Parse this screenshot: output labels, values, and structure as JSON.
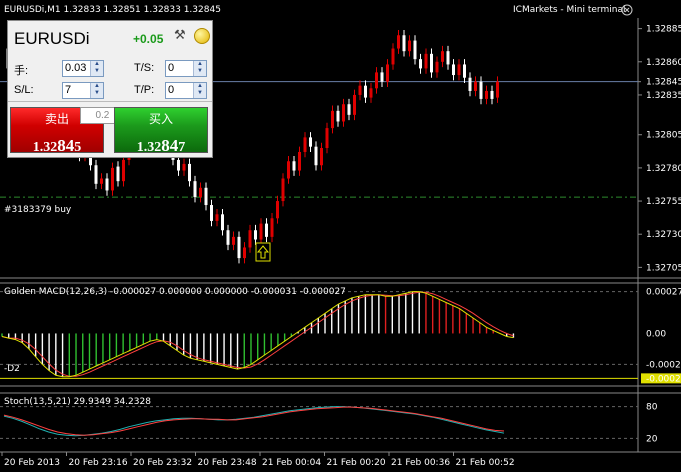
{
  "window": {
    "title": "EURUSDi,M1 1.32833 1.32851 1.32833 1.32845",
    "terminal_label": "ICMarkets - Mini terminal",
    "close_glyph": "ⓧ"
  },
  "panel": {
    "symbol": "EURUSDi",
    "change": "+0.05",
    "lots_label": "手:",
    "lots_value": "0.03",
    "sl_label": "S/L:",
    "sl_value": "7",
    "ts_label": "T/S:",
    "ts_value": "0",
    "tp_label": "T/P:",
    "tp_value": "0",
    "volume_step": "0.2",
    "sell_label": "卖出",
    "sell_price_small": "1.32",
    "sell_price_big": "84",
    "sell_price_tail": "5",
    "buy_label": "买入",
    "buy_price_small": "1.32",
    "buy_price_big": "84",
    "buy_price_tail": "7"
  },
  "icons": {
    "tool": "tools-icon",
    "coin": "coin-icon",
    "arrow": "up-arrow-icon",
    "spin": "spinner-arrows-icon"
  },
  "colors": {
    "bull": "#ffffff",
    "bear": "#e00000",
    "grid": "#666666",
    "order_line": "#2e8b2e",
    "bid_line": "#6a7fa8",
    "macd_line": "#e0e000",
    "signal_line": "#ff4040",
    "stoch_main": "#20b0b0",
    "stoch_signal": "#ff4040"
  },
  "chart_data": [
    {
      "type": "candlestick",
      "title": "EURUSDi,M1 1.32833 1.32851 1.32833 1.32845",
      "y_ticks": [
        "1.32885",
        "1.32860",
        "1.32845",
        "1.32835",
        "1.32805",
        "1.32780",
        "1.32755",
        "1.32730",
        "1.32705"
      ],
      "current_price": "1.32845",
      "order_label": "#3183379 buy",
      "order_price": 1.32758,
      "x_ticks": [
        "20 Feb 2013",
        "20 Feb 23:16",
        "20 Feb 23:32",
        "20 Feb 23:48",
        "21 Feb 00:04",
        "21 Feb 00:20",
        "21 Feb 00:36",
        "21 Feb 00:52"
      ],
      "candles": [
        [
          1.3287,
          1.32855
        ],
        [
          1.32856,
          1.32848
        ],
        [
          1.3285,
          1.32862
        ],
        [
          1.32861,
          1.32845
        ],
        [
          1.32846,
          1.32838
        ],
        [
          1.32838,
          1.32852
        ],
        [
          1.32853,
          1.3284
        ],
        [
          1.3284,
          1.32825
        ],
        [
          1.32826,
          1.32833
        ],
        [
          1.32834,
          1.32818
        ],
        [
          1.32818,
          1.32808
        ],
        [
          1.32808,
          1.32815
        ],
        [
          1.32815,
          1.32798
        ],
        [
          1.32797,
          1.32789
        ],
        [
          1.32789,
          1.32795
        ],
        [
          1.32795,
          1.32782
        ],
        [
          1.32782,
          1.32768
        ],
        [
          1.32768,
          1.32772
        ],
        [
          1.32772,
          1.32763
        ],
        [
          1.32763,
          1.3278
        ],
        [
          1.32781,
          1.3277
        ],
        [
          1.3277,
          1.32786
        ],
        [
          1.32786,
          1.328
        ],
        [
          1.328,
          1.32792
        ],
        [
          1.32792,
          1.32806
        ],
        [
          1.32806,
          1.32798
        ],
        [
          1.32798,
          1.32812
        ],
        [
          1.32812,
          1.32803
        ],
        [
          1.32803,
          1.32795
        ],
        [
          1.32795,
          1.328
        ],
        [
          1.328,
          1.32786
        ],
        [
          1.32786,
          1.32778
        ],
        [
          1.32778,
          1.32783
        ],
        [
          1.32783,
          1.3277
        ],
        [
          1.3277,
          1.32758
        ],
        [
          1.32758,
          1.32765
        ],
        [
          1.32765,
          1.32752
        ],
        [
          1.32752,
          1.3274
        ],
        [
          1.3274,
          1.32745
        ],
        [
          1.32745,
          1.32733
        ],
        [
          1.32733,
          1.32722
        ],
        [
          1.32722,
          1.32728
        ],
        [
          1.32728,
          1.32712
        ],
        [
          1.32712,
          1.3272
        ],
        [
          1.3272,
          1.32733
        ],
        [
          1.32733,
          1.32726
        ],
        [
          1.32726,
          1.32738
        ],
        [
          1.32738,
          1.32728
        ],
        [
          1.32728,
          1.32742
        ],
        [
          1.32742,
          1.32755
        ],
        [
          1.32755,
          1.32772
        ],
        [
          1.32772,
          1.32785
        ],
        [
          1.32785,
          1.32778
        ],
        [
          1.32778,
          1.32792
        ],
        [
          1.32792,
          1.32803
        ],
        [
          1.32803,
          1.32796
        ],
        [
          1.32796,
          1.32782
        ],
        [
          1.32782,
          1.32795
        ],
        [
          1.32795,
          1.3281
        ],
        [
          1.3281,
          1.32823
        ],
        [
          1.32823,
          1.32815
        ],
        [
          1.32815,
          1.32828
        ],
        [
          1.32828,
          1.3282
        ],
        [
          1.3282,
          1.32835
        ],
        [
          1.32835,
          1.32842
        ],
        [
          1.32842,
          1.32833
        ],
        [
          1.32833,
          1.3284
        ],
        [
          1.3284,
          1.32852
        ],
        [
          1.32852,
          1.32845
        ],
        [
          1.32845,
          1.32858
        ],
        [
          1.32858,
          1.3287
        ],
        [
          1.3287,
          1.3288
        ],
        [
          1.3288,
          1.32868
        ],
        [
          1.32868,
          1.32876
        ],
        [
          1.32876,
          1.32862
        ],
        [
          1.32862,
          1.32855
        ],
        [
          1.32855,
          1.32866
        ],
        [
          1.32866,
          1.32852
        ],
        [
          1.32852,
          1.3286
        ],
        [
          1.3286,
          1.32868
        ],
        [
          1.32868,
          1.32858
        ],
        [
          1.32858,
          1.3285
        ],
        [
          1.3285,
          1.32858
        ],
        [
          1.32858,
          1.32848
        ],
        [
          1.32848,
          1.32838
        ],
        [
          1.32838,
          1.32845
        ],
        [
          1.32845,
          1.32832
        ],
        [
          1.32832,
          1.32838
        ],
        [
          1.32838,
          1.32832
        ],
        [
          1.32833,
          1.32845
        ]
      ]
    },
    {
      "type": "histogram",
      "title": "Golden MACD(12,26,3) -0.000027 0.000000 0.000000 -0.000031 -0.000027",
      "y_ticks": [
        "0.00027",
        "0.00",
        "-0.0002",
        "-0.00029"
      ],
      "series_label_left": "-D2",
      "values": [
        -2e-05,
        -3e-05,
        -4e-05,
        -6e-05,
        -0.0001,
        -0.00015,
        -0.0002,
        -0.00024,
        -0.00027,
        -0.00028,
        -0.00028,
        -0.00027,
        -0.00025,
        -0.00023,
        -0.00021,
        -0.00019,
        -0.00017,
        -0.00015,
        -0.00013,
        -0.00011,
        -9e-05,
        -7e-05,
        -5e-05,
        -4e-05,
        -5e-05,
        -8e-05,
        -0.00011,
        -0.00014,
        -0.00016,
        -0.00017,
        -0.00018,
        -0.00019,
        -0.0002,
        -0.00021,
        -0.00022,
        -0.00023,
        -0.00022,
        -0.0002,
        -0.00017,
        -0.00014,
        -0.00011,
        -8e-05,
        -5e-05,
        -2e-05,
        1e-05,
        4e-05,
        7e-05,
        0.0001,
        0.00013,
        0.00016,
        0.00019,
        0.00021,
        0.00023,
        0.00024,
        0.00025,
        0.00025,
        0.00025,
        0.00024,
        0.00024,
        0.00025,
        0.00026,
        0.00027,
        0.00027,
        0.00026,
        0.00024,
        0.00022,
        0.0002,
        0.00018,
        0.00016,
        0.00013,
        0.0001,
        7e-05,
        4e-05,
        2e-05,
        0.0,
        -2e-05,
        -2.7e-05
      ]
    },
    {
      "type": "line",
      "title": "Stoch(13,5,21) 29.9349 34.2328",
      "y_ticks": [
        "80",
        "20"
      ],
      "ylim": [
        0,
        100
      ],
      "series": [
        {
          "name": "main",
          "values": [
            62,
            58,
            52,
            45,
            38,
            32,
            28,
            26,
            25,
            26,
            28,
            30,
            33,
            37,
            42,
            46,
            50,
            53,
            55,
            57,
            58,
            58,
            57,
            56,
            55,
            55,
            56,
            58,
            60,
            63,
            66,
            69,
            72,
            74,
            76,
            78,
            79,
            80,
            80,
            79,
            78,
            76,
            74,
            72,
            70,
            68,
            66,
            63,
            60,
            56,
            52,
            48,
            44,
            40,
            36,
            33,
            30
          ]
        },
        {
          "name": "signal",
          "values": [
            64,
            60,
            55,
            49,
            43,
            37,
            32,
            29,
            27,
            26,
            27,
            29,
            31,
            34,
            38,
            42,
            46,
            50,
            53,
            55,
            56,
            57,
            57,
            56,
            56,
            55,
            55,
            57,
            59,
            61,
            64,
            67,
            70,
            72,
            74,
            76,
            77,
            78,
            79,
            79,
            78,
            77,
            75,
            73,
            71,
            69,
            67,
            64,
            61,
            58,
            54,
            50,
            46,
            42,
            38,
            35,
            34
          ]
        }
      ]
    }
  ]
}
